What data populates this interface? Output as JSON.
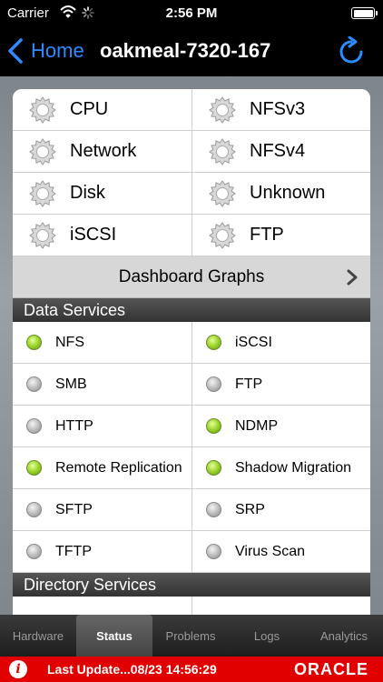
{
  "status_bar": {
    "carrier": "Carrier",
    "time": "2:56 PM",
    "battery_level": 1.0
  },
  "nav": {
    "back_label": "Home",
    "title": "oakmeal-7320-167",
    "accent_color": "#2e8bff"
  },
  "graphs": [
    {
      "label": "CPU"
    },
    {
      "label": "NFSv3"
    },
    {
      "label": "Network"
    },
    {
      "label": "NFSv4"
    },
    {
      "label": "Disk"
    },
    {
      "label": "Unknown"
    },
    {
      "label": "iSCSI"
    },
    {
      "label": "FTP"
    }
  ],
  "dashboard_graphs_label": "Dashboard Graphs",
  "data_services": {
    "header": "Data Services",
    "items": [
      {
        "label": "NFS",
        "status": "on"
      },
      {
        "label": "iSCSI",
        "status": "on"
      },
      {
        "label": "SMB",
        "status": "off"
      },
      {
        "label": "FTP",
        "status": "off"
      },
      {
        "label": "HTTP",
        "status": "off"
      },
      {
        "label": "NDMP",
        "status": "on"
      },
      {
        "label": "Remote Replication",
        "status": "on"
      },
      {
        "label": "Shadow Migration",
        "status": "on"
      },
      {
        "label": "SFTP",
        "status": "off"
      },
      {
        "label": "SRP",
        "status": "off"
      },
      {
        "label": "TFTP",
        "status": "off"
      },
      {
        "label": "Virus Scan",
        "status": "off"
      }
    ]
  },
  "directory_services": {
    "header": "Directory Services"
  },
  "tabs": [
    {
      "label": "Hardware",
      "active": false
    },
    {
      "label": "Status",
      "active": true
    },
    {
      "label": "Problems",
      "active": false
    },
    {
      "label": "Logs",
      "active": false
    },
    {
      "label": "Analytics",
      "active": false
    }
  ],
  "footer": {
    "info_icon": "i",
    "last_update": "Last Update...08/23 14:56:29",
    "logo": "ORACLE",
    "color": "#e10000"
  },
  "icons": {
    "graph_icon": "gear-icon",
    "back_icon": "chevron-left-icon",
    "refresh_icon": "refresh-icon"
  }
}
